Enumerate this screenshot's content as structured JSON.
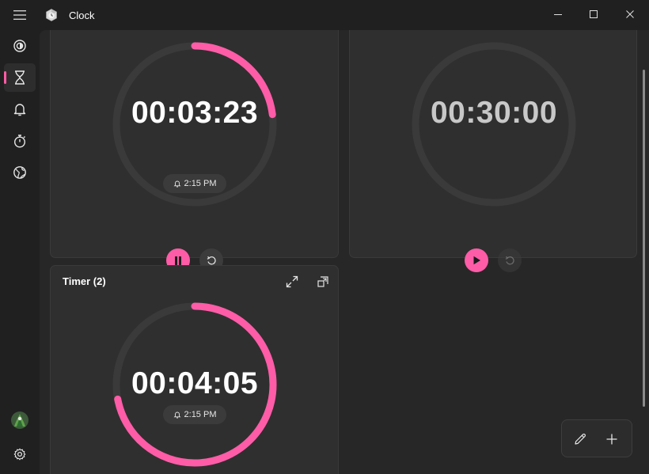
{
  "app": {
    "title": "Clock"
  },
  "colors": {
    "accent": "#ff5ca8",
    "track": "#3a3a3a"
  },
  "timers": [
    {
      "time": "00:03:23",
      "alarm": "2:15 PM",
      "progress": 0.23,
      "state": "running"
    },
    {
      "time": "00:30:00",
      "alarm": "",
      "progress": 0,
      "state": "stopped"
    },
    {
      "title": "Timer (2)",
      "time": "00:04:05",
      "alarm": "2:15 PM",
      "progress": 0.72,
      "state": "running"
    }
  ],
  "nav": {
    "items": [
      "focus-sessions-icon",
      "timer-icon",
      "alarm-icon",
      "stopwatch-icon",
      "world-clock-icon"
    ],
    "active": "timer"
  }
}
